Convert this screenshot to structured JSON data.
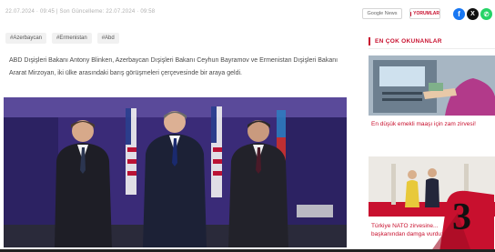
{
  "meta": {
    "date_text": "22.07.2024 · 09:45 | Son Güncelleme: 22.07.2024 · 09:58"
  },
  "header_buttons": {
    "google_label": "Google News",
    "comments_label": "YORUMLAR"
  },
  "social": {
    "facebook_glyph": "f",
    "x_glyph": "X",
    "whatsapp_glyph": "✆"
  },
  "tags": [
    "#Azerbaycan",
    "#Ermenistan",
    "#Abd"
  ],
  "article": {
    "summary": "ABD Dışişleri Bakanı Antony Blinken, Azerbaycan Dışişleri Bakanı Ceyhun Bayramov ve Ermenistan Dışişleri Bakanı Ararat Mirzoyan, iki ülke arasındaki barış görüşmeleri çerçevesinde bir araya geldi."
  },
  "sidebar": {
    "heading": "EN ÇOK OKUNANLAR",
    "items": [
      {
        "title": "En düşük emekli maaşı için zam zirvesi!"
      },
      {
        "title": "Türkiye NATO zirvesine... başkanından damga vurdu: Baş..."
      }
    ],
    "badge_number": "3"
  },
  "colors": {
    "accent": "#c8102e",
    "facebook": "#1877f2",
    "whatsapp": "#25d366"
  }
}
